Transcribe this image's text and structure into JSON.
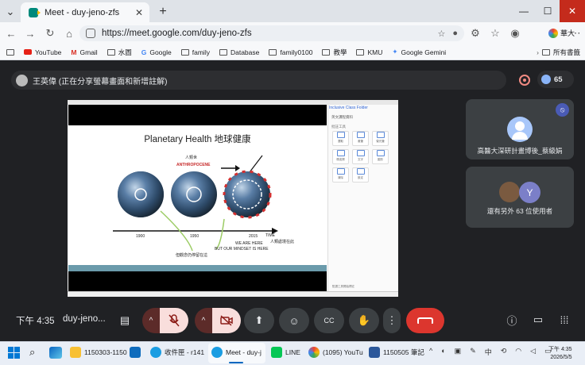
{
  "browser": {
    "tab_title": "Meet - duy-jeno-zfs",
    "tab_close": "✕",
    "new_tab": "+",
    "url": "https://meet.google.com/duy-jeno-zfs",
    "profile_label": "華大",
    "bookmarks": [
      "YouTube",
      "Gmail",
      "水圖",
      "Google",
      "family",
      "Database",
      "family0100",
      "教學",
      "KMU",
      "Google Gemini"
    ],
    "bookmarks_more": "所有書籤",
    "window_controls": [
      "—",
      "☐",
      "✕"
    ]
  },
  "meet": {
    "presenter_text": "王英偉 (正在分享螢幕畫面和新增註解)",
    "participant_count": "65",
    "time": "下午 4:35",
    "meeting_code": "duy-jeno...",
    "tile1_name": "高醫大深研計畫博後_蔡級娟",
    "tile2_name": "還有另外 63 位使用者",
    "tile2_initial": "Y",
    "colors": {
      "bg": "#202124",
      "leave": "#dc362e",
      "muted": "#f9dedc"
    }
  },
  "slide": {
    "title": "Planetary Health 地球健康",
    "anthropocene_zh": "人類世",
    "anthropocene_en": "ANTHROPOCENE",
    "year_1": "1900",
    "year_2": "1950",
    "year_3": "2015",
    "time_label": "TIME",
    "we_are_here_zh": "人類處境在此",
    "we_are_here": "WE ARE HERE",
    "mindset": "BUT OUR MINDSET IS HERE",
    "mindset_zh": "但觀念仍停留在這"
  },
  "panel": {
    "title": "Inclusive Class Folder",
    "sub": "英文課程資料",
    "sub2": "批註工具",
    "tiles": [
      "選取",
      "畫筆",
      "螢光筆",
      "橡皮擦",
      "文字",
      "圖形",
      "清除",
      "設定"
    ],
    "footer": "點選工具開始標註"
  },
  "taskbar": {
    "items": [
      "1150303-1150",
      "收件匣 - r141",
      "Meet - duy-j",
      "LINE",
      "(1095) YouTu",
      "1150505 筆記"
    ],
    "clock_time": "下午 4:35",
    "clock_date": "2026/5/5",
    "ime": "中"
  }
}
